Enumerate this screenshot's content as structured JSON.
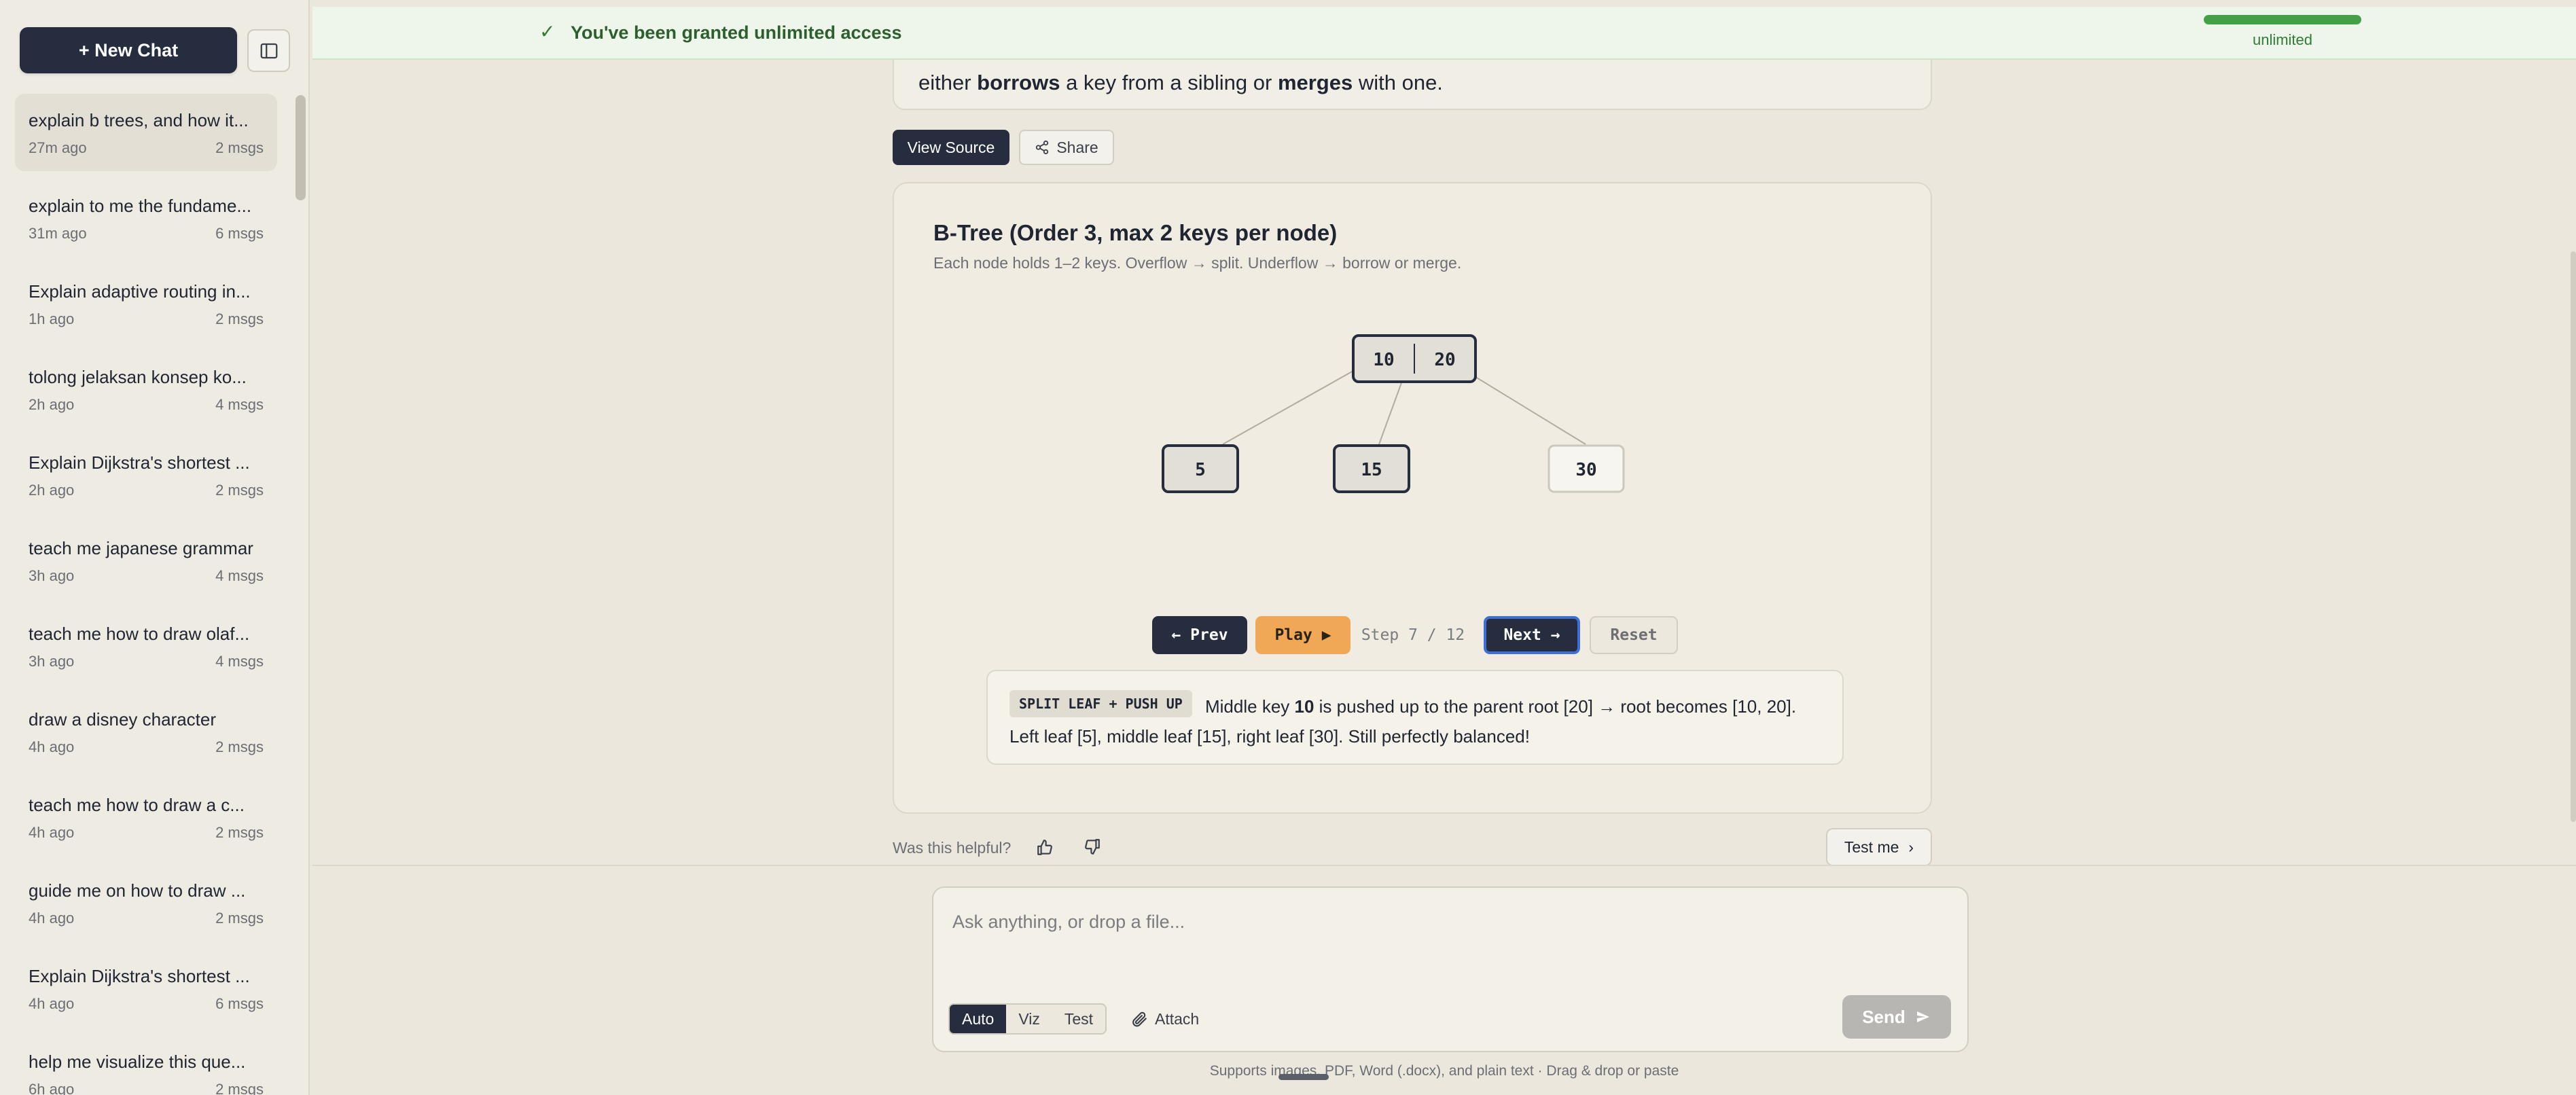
{
  "sidebar": {
    "new_chat_label": "+ New Chat",
    "chats": [
      {
        "title": "explain b trees, and how it...",
        "time": "27m ago",
        "count": "2 msgs",
        "active": true
      },
      {
        "title": "explain to me the fundame...",
        "time": "31m ago",
        "count": "6 msgs"
      },
      {
        "title": "Explain adaptive routing in...",
        "time": "1h ago",
        "count": "2 msgs"
      },
      {
        "title": "tolong jelaksan konsep ko...",
        "time": "2h ago",
        "count": "4 msgs"
      },
      {
        "title": "Explain Dijkstra's shortest ...",
        "time": "2h ago",
        "count": "2 msgs"
      },
      {
        "title": "teach me japanese grammar",
        "time": "3h ago",
        "count": "4 msgs"
      },
      {
        "title": "teach me how to draw olaf...",
        "time": "3h ago",
        "count": "4 msgs"
      },
      {
        "title": "draw a disney character",
        "time": "4h ago",
        "count": "2 msgs"
      },
      {
        "title": "teach me how to draw a c...",
        "time": "4h ago",
        "count": "2 msgs"
      },
      {
        "title": "guide me on how to draw ...",
        "time": "4h ago",
        "count": "2 msgs"
      },
      {
        "title": "Explain Dijkstra's shortest ...",
        "time": "4h ago",
        "count": "6 msgs"
      },
      {
        "title": "help me visualize this que...",
        "time": "6h ago",
        "count": "2 msgs"
      }
    ]
  },
  "banner": {
    "message": "You've been granted unlimited access",
    "usage_label": "unlimited",
    "usage_fraction": 1.0
  },
  "message": {
    "text_before_1": "either ",
    "bold_1": "borrows",
    "text_between": " a key from a sibling or ",
    "bold_2": "merges",
    "text_after": " with one."
  },
  "actions": {
    "view_source_label": "View Source",
    "share_label": "Share"
  },
  "visualization": {
    "title": "B-Tree (Order 3, max 2 keys per node)",
    "subtitle": "Each node holds 1–2 keys. Overflow → split. Underflow → borrow or merge.",
    "tree": {
      "root": {
        "keys": [
          "10",
          "20"
        ]
      },
      "children": [
        {
          "keys": [
            "5"
          ],
          "highlighted": true
        },
        {
          "keys": [
            "15"
          ],
          "highlighted": true
        },
        {
          "keys": [
            "30"
          ],
          "highlighted": false
        }
      ]
    },
    "controls": {
      "prev_label": "← Prev",
      "play_label": "Play ▶",
      "step_label": "Step 7 / 12",
      "next_label": "Next →",
      "reset_label": "Reset"
    },
    "step_badge": "SPLIT LEAF + PUSH UP",
    "explanation_pre": "Middle key ",
    "explanation_key": "10",
    "explanation_post": " is pushed up to the parent root [20] → root becomes [10, 20]. Left leaf [5], middle leaf [15], right leaf [30]. Still perfectly balanced!"
  },
  "feedback": {
    "helpful_label": "Was this helpful?",
    "test_me_label": "Test me"
  },
  "composer": {
    "placeholder": "Ask anything, or drop a file...",
    "modes": [
      "Auto",
      "Viz",
      "Test"
    ],
    "active_mode": "Auto",
    "attach_label": "Attach",
    "send_label": "Send",
    "footer_hint": "Supports images, PDF, Word (.docx), and plain text · Drag & drop or paste"
  },
  "colors": {
    "dark": "#252d3e",
    "accent_orange": "#f0a857",
    "success_green": "#43a047",
    "focus_blue": "#3d6fd6"
  }
}
